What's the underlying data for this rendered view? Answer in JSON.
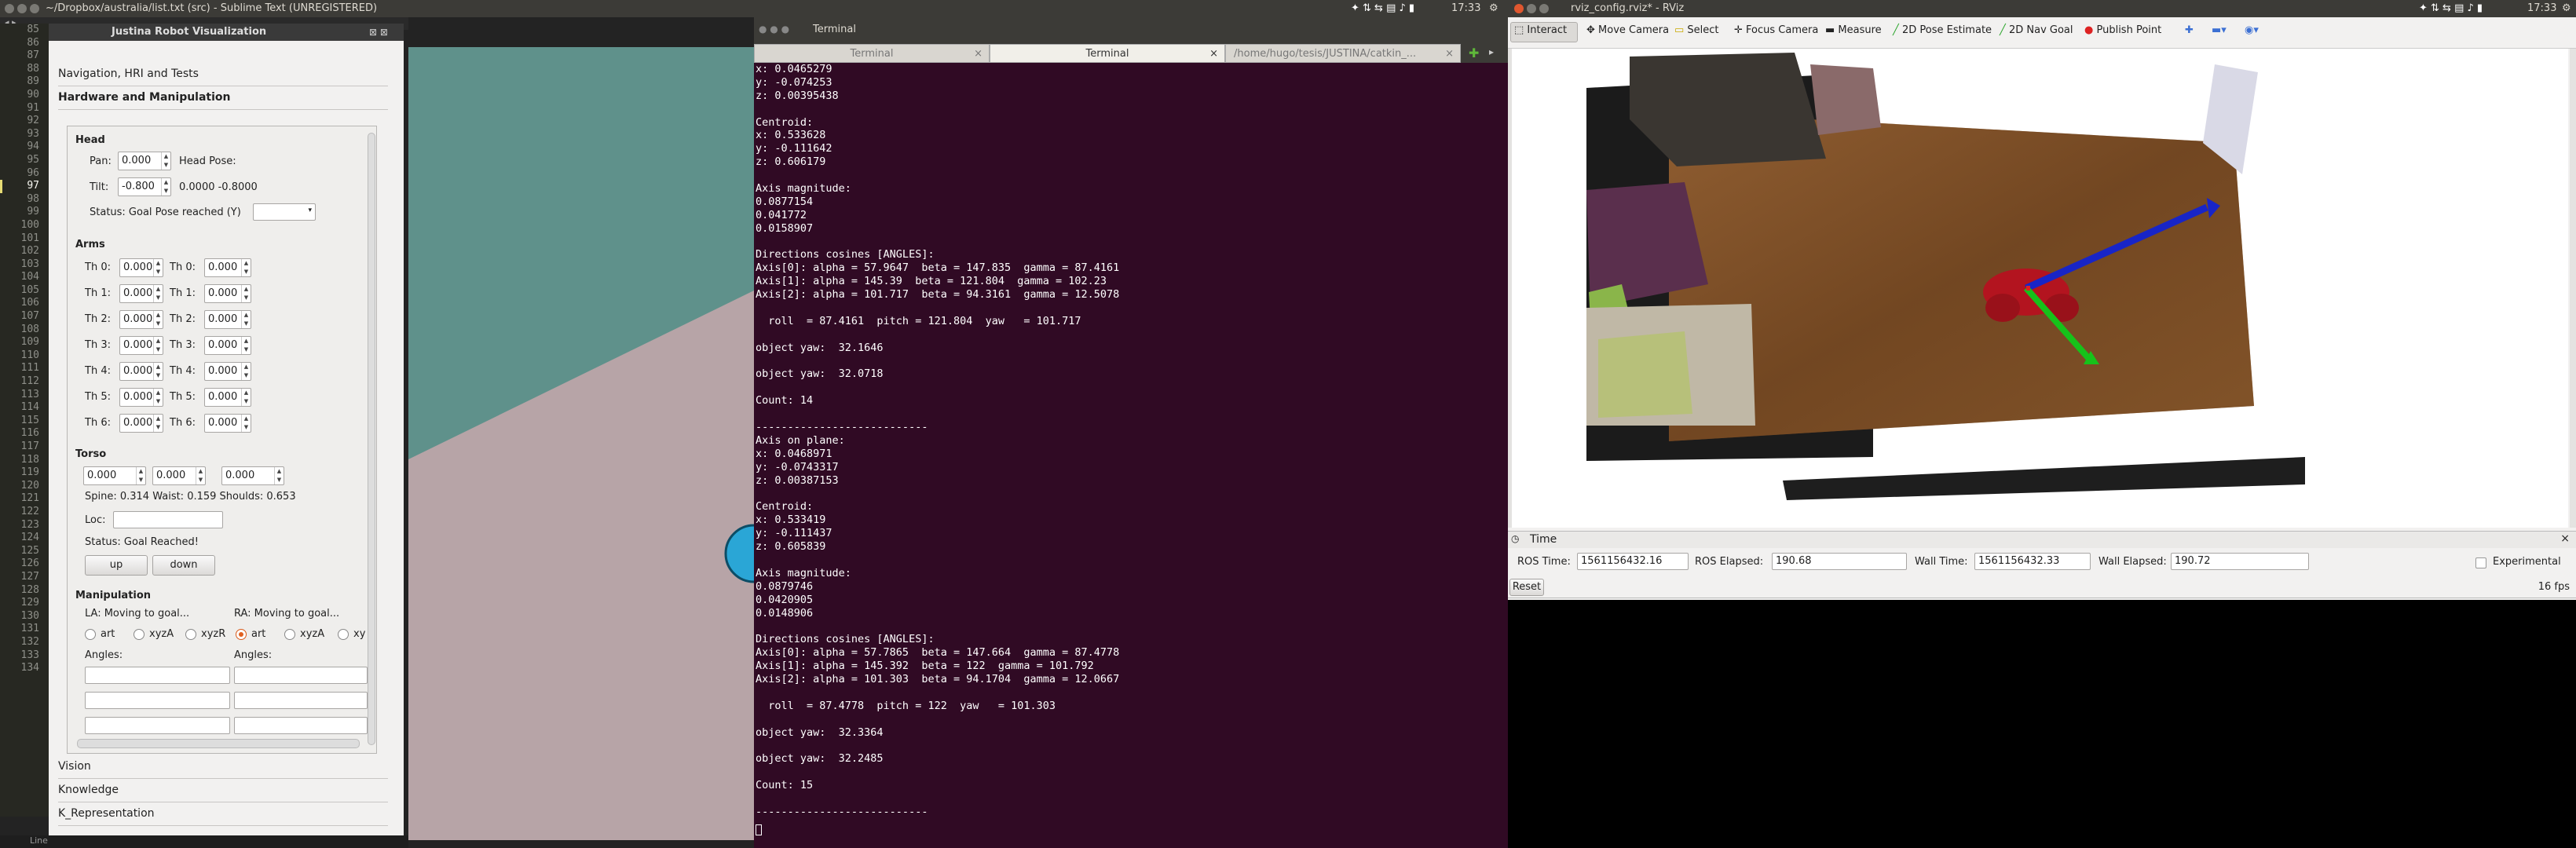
{
  "topbar": {
    "sublime_title": "~/Dropbox/australia/list.txt (src) - Sublime Text (UNREGISTERED)",
    "time_left": "17:33",
    "rviz_title": "rviz_config.rviz* - RViz",
    "time_right": "17:33"
  },
  "gutter": {
    "lines": [
      "85",
      "86",
      "87",
      "88",
      "89",
      "90",
      "91",
      "92",
      "93",
      "94",
      "95",
      "96",
      "97",
      "98",
      "99",
      "100",
      "101",
      "102",
      "103",
      "104",
      "105",
      "106",
      "107",
      "108",
      "109",
      "110",
      "111",
      "112",
      "113",
      "114",
      "115",
      "116",
      "117",
      "118",
      "119",
      "120",
      "121",
      "122",
      "123",
      "124",
      "125",
      "126",
      "127",
      "128",
      "129",
      "130",
      "131",
      "132",
      "133",
      "134"
    ]
  },
  "jr": {
    "title": "Justina Robot Visualization",
    "sections_top": [
      "Navigation, HRI and Tests",
      "Hardware and Manipulation"
    ],
    "head": {
      "label": "Head",
      "pan_label": "Pan:",
      "pan": "0.000",
      "head_pose_label": "Head Pose:",
      "tilt_label": "Tilt:",
      "tilt": "-0.800",
      "pose_values": "0.0000  -0.8000",
      "status": "Status: Goal Pose reached (Y)"
    },
    "arms": {
      "label": "Arms",
      "rows": [
        {
          "l": "Th 0:",
          "lv": "0.000",
          "r": "Th 0:",
          "rv": "0.000"
        },
        {
          "l": "Th 1:",
          "lv": "0.000",
          "r": "Th 1:",
          "rv": "0.000"
        },
        {
          "l": "Th 2:",
          "lv": "0.000",
          "r": "Th 2:",
          "rv": "0.000"
        },
        {
          "l": "Th 3:",
          "lv": "0.000",
          "r": "Th 3:",
          "rv": "0.000"
        },
        {
          "l": "Th 4:",
          "lv": "0.000",
          "r": "Th 4:",
          "rv": "0.000"
        },
        {
          "l": "Th 5:",
          "lv": "0.000",
          "r": "Th 5:",
          "rv": "0.000"
        },
        {
          "l": "Th 6:",
          "lv": "0.000",
          "r": "Th 6:",
          "rv": "0.000"
        }
      ]
    },
    "torso": {
      "label": "Torso",
      "values": [
        "0.000",
        "0.000",
        "0.000"
      ],
      "readout": "Spine: 0.314   Waist: 0.159   Shoulds: 0.653",
      "loc_label": "Loc:",
      "status": "Status: Goal Reached!",
      "up": "up",
      "down": "down"
    },
    "manip": {
      "label": "Manipulation",
      "la": "LA: Moving to goal...",
      "ra": "RA: Moving to goal...",
      "la_opts": [
        "art",
        "xyzA",
        "xyzR"
      ],
      "ra_opts": [
        "art",
        "xyzA",
        "xy"
      ],
      "angles": "Angles:"
    },
    "sections_bottom": [
      "Vision",
      "Knowledge",
      "K_Representation"
    ]
  },
  "status_bar": "Line",
  "terminal": {
    "title": "Terminal",
    "tabs": [
      "Terminal",
      "Terminal",
      "/home/hugo/tesis/JUSTINA/catkin_..."
    ],
    "lines": [
      "x: 0.0465279",
      "y: -0.074253",
      "z: 0.00395438",
      "",
      "Centroid:",
      "x: 0.533628",
      "y: -0.111642",
      "z: 0.606179",
      "",
      "Axis magnitude:",
      "0.0877154",
      "0.041772",
      "0.0158907",
      "",
      "Directions cosines [ANGLES]:",
      "Axis[0]: alpha = 57.9647  beta = 147.835  gamma = 87.4161",
      "Axis[1]: alpha = 145.39  beta = 121.804  gamma = 102.23",
      "Axis[2]: alpha = 101.717  beta = 94.3161  gamma = 12.5078",
      "",
      "  roll  = 87.4161  pitch = 121.804  yaw   = 101.717",
      "",
      "object yaw:  32.1646",
      "",
      "object yaw:  32.0718",
      "",
      "Count: 14",
      "",
      "---------------------------",
      "Axis on plane:",
      "x: 0.0468971",
      "y: -0.0743317",
      "z: 0.00387153",
      "",
      "Centroid:",
      "x: 0.533419",
      "y: -0.111437",
      "z: 0.605839",
      "",
      "Axis magnitude:",
      "0.0879746",
      "0.0420905",
      "0.0148906",
      "",
      "Directions cosines [ANGLES]:",
      "Axis[0]: alpha = 57.7865  beta = 147.664  gamma = 87.4778",
      "Axis[1]: alpha = 145.392  beta = 122  gamma = 101.792",
      "Axis[2]: alpha = 101.303  beta = 94.1704  gamma = 12.0667",
      "",
      "  roll  = 87.4778  pitch = 122  yaw   = 101.303",
      "",
      "object yaw:  32.3364",
      "",
      "object yaw:  32.2485",
      "",
      "Count: 15",
      "",
      "---------------------------"
    ]
  },
  "rviz": {
    "tools": [
      "Interact",
      "Move Camera",
      "Select",
      "Focus Camera",
      "Measure",
      "2D Pose Estimate",
      "2D Nav Goal",
      "Publish Point"
    ],
    "time_panel": "Time",
    "ros_time_label": "ROS Time:",
    "ros_time": "1561156432.16",
    "ros_elapsed_label": "ROS Elapsed:",
    "ros_elapsed": "190.68",
    "wall_time_label": "Wall Time:",
    "wall_time": "1561156432.33",
    "wall_elapsed_label": "Wall Elapsed:",
    "wall_elapsed": "190.72",
    "experimental": "Experimental",
    "reset": "Reset",
    "fps": "16 fps"
  }
}
